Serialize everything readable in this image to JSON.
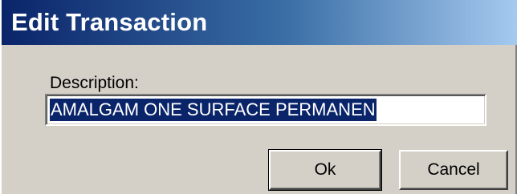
{
  "window": {
    "title": "Edit Transaction"
  },
  "form": {
    "description_label": "Description:",
    "description_value": "AMALGAM ONE SURFACE PERMANEN"
  },
  "buttons": {
    "ok_label": "Ok",
    "cancel_label": "Cancel"
  },
  "colors": {
    "titlebar_start": "#0a246a",
    "titlebar_end": "#a6caf0",
    "selection": "#0a246a",
    "dialog_bg": "#d4d0c8"
  }
}
